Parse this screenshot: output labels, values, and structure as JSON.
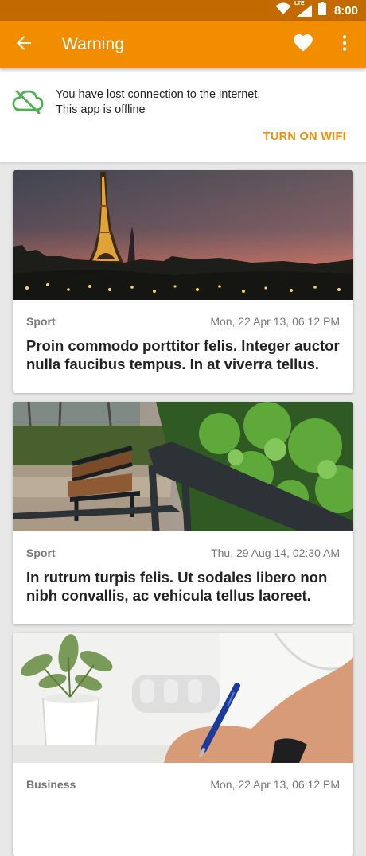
{
  "status_bar": {
    "time": "8:00",
    "network_label": "LTE",
    "icons": [
      "wifi-icon",
      "signal-icon",
      "battery-icon"
    ],
    "background_color": "#c26a00"
  },
  "app_bar": {
    "title": "Warning",
    "background_color": "#f38d00",
    "icons": [
      "back-arrow-icon",
      "heart-icon",
      "more-vert-icon"
    ]
  },
  "offline_banner": {
    "icon": "cloud-off-icon",
    "icon_color": "#4caf50",
    "line1": "You have lost connection to the internet.",
    "line2": "This app is offline",
    "action_label": "TURN ON WIFI",
    "action_color": "#f38d00"
  },
  "cards": [
    {
      "category": "Sport",
      "date": "Mon, 22 Apr 13, 06:12 PM",
      "title": "Proin commodo porttitor felis. Integer auctor nulla faucibus tempus. In at viverra tellus.",
      "image": "eiffel-tower-night-photo"
    },
    {
      "category": "Sport",
      "date": "Thu, 29 Aug 14, 02:30 AM",
      "title": "In rutrum turpis felis. Ut sodales libero non nibh convallis, ac vehicula tellus laoreet.",
      "image": "park-bench-photo"
    },
    {
      "category": "Business",
      "date": "Mon, 22 Apr 13, 06:12 PM",
      "title": "",
      "image": "hand-writing-desk-photo"
    }
  ]
}
